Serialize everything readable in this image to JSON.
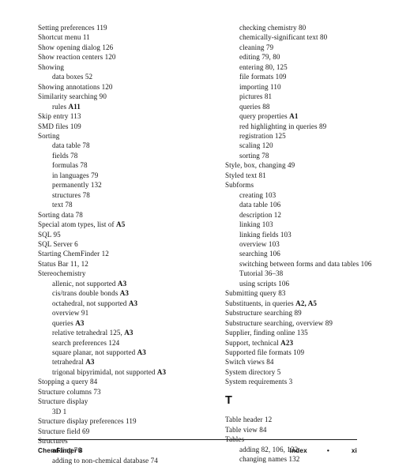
{
  "page": {
    "kind": "book-index-page",
    "background_color": "#ffffff",
    "text_color": "#161616"
  },
  "left_column": {
    "entries": [
      {
        "level": 0,
        "text": "Setting preferences 119"
      },
      {
        "level": 0,
        "text": "Shortcut menu 11"
      },
      {
        "level": 0,
        "text": "Show opening dialog 126"
      },
      {
        "level": 0,
        "text": "Show reaction centers 120"
      },
      {
        "level": 0,
        "text": "Showing"
      },
      {
        "level": 1,
        "text": "data boxes 52"
      },
      {
        "level": 0,
        "text": "Showing annotations 120"
      },
      {
        "level": 0,
        "text": "Similarity searching 90"
      },
      {
        "level": 1,
        "text": "rules ",
        "bold_suffix": "A11"
      },
      {
        "level": 0,
        "text": "Skip entry 113"
      },
      {
        "level": 0,
        "text": "SMD files 109"
      },
      {
        "level": 0,
        "text": "Sorting"
      },
      {
        "level": 1,
        "text": "data table 78"
      },
      {
        "level": 1,
        "text": "fields 78"
      },
      {
        "level": 1,
        "text": "formulas 78"
      },
      {
        "level": 1,
        "text": "in languages 79"
      },
      {
        "level": 1,
        "text": "permanently 132"
      },
      {
        "level": 1,
        "text": "structures 78"
      },
      {
        "level": 1,
        "text": "text 78"
      },
      {
        "level": 0,
        "text": "Sorting data 78"
      },
      {
        "level": 0,
        "text": "Special atom types, list of ",
        "bold_suffix": "A5"
      },
      {
        "level": 0,
        "text": "SQL 95"
      },
      {
        "level": 0,
        "text": "SQL Server 6"
      },
      {
        "level": 0,
        "text": "Starting ChemFinder 12"
      },
      {
        "level": 0,
        "text": "Status Bar 11, 12"
      },
      {
        "level": 0,
        "text": "Stereochemistry"
      },
      {
        "level": 1,
        "text": "allenic, not supported ",
        "bold_suffix": "A3"
      },
      {
        "level": 1,
        "text": "cis/trans double bonds ",
        "bold_suffix": "A3"
      },
      {
        "level": 1,
        "text": "octahedral, not supported ",
        "bold_suffix": "A3"
      },
      {
        "level": 1,
        "text": "overview 91"
      },
      {
        "level": 1,
        "text": "queries ",
        "bold_suffix": "A3"
      },
      {
        "level": 1,
        "text": "relative tetrahedral 125, ",
        "bold_suffix": "A3"
      },
      {
        "level": 1,
        "text": "search preferences 124"
      },
      {
        "level": 1,
        "text": "square planar, not supported ",
        "bold_suffix": "A3"
      },
      {
        "level": 1,
        "text": "tetrahedral ",
        "bold_suffix": "A3"
      },
      {
        "level": 1,
        "text": "trigonal bipyrimidal, not supported ",
        "bold_suffix": "A3"
      },
      {
        "level": 0,
        "text": "Stopping a query 84"
      },
      {
        "level": 0,
        "text": "Structure columns 73"
      },
      {
        "level": 0,
        "text": "Structure display"
      },
      {
        "level": 1,
        "text": "3D 1"
      },
      {
        "level": 0,
        "text": "Structure display preferences 119"
      },
      {
        "level": 0,
        "text": "Structure field 69"
      },
      {
        "level": 0,
        "text": "Structures"
      },
      {
        "level": 1,
        "text": "adding 76"
      },
      {
        "level": 1,
        "text": "adding to non-chemical database 74"
      }
    ]
  },
  "right_column": {
    "entries": [
      {
        "level": 1,
        "text": "checking chemistry 80"
      },
      {
        "level": 1,
        "text": "chemically-significant text 80"
      },
      {
        "level": 1,
        "text": "cleaning 79"
      },
      {
        "level": 1,
        "text": "editing 79, 80"
      },
      {
        "level": 1,
        "text": "entering 80, 125"
      },
      {
        "level": 1,
        "text": "file formats 109"
      },
      {
        "level": 1,
        "text": "importing 110"
      },
      {
        "level": 1,
        "text": "pictures 81"
      },
      {
        "level": 1,
        "text": "queries 88"
      },
      {
        "level": 1,
        "text": "query properties ",
        "bold_suffix": "A1"
      },
      {
        "level": 1,
        "text": "red highlighting in queries 89"
      },
      {
        "level": 1,
        "text": "registration 125"
      },
      {
        "level": 1,
        "text": "scaling 120"
      },
      {
        "level": 1,
        "text": "sorting 78"
      },
      {
        "level": 0,
        "text": "Style, box, changing 49"
      },
      {
        "level": 0,
        "text": "Styled text 81"
      },
      {
        "level": 0,
        "text": "Subforms"
      },
      {
        "level": 1,
        "text": "creating 103"
      },
      {
        "level": 1,
        "text": "data table 106"
      },
      {
        "level": 1,
        "text": "description 12"
      },
      {
        "level": 1,
        "text": "linking 103"
      },
      {
        "level": 1,
        "text": "linking fields 103"
      },
      {
        "level": 1,
        "text": "overview 103"
      },
      {
        "level": 1,
        "text": "searching 106"
      },
      {
        "level": 1,
        "text": "switching between forms and data tables 106"
      },
      {
        "level": 1,
        "text": "Tutorial 36–38"
      },
      {
        "level": 1,
        "text": "using scripts 106"
      },
      {
        "level": 0,
        "text": "Submitting query 83"
      },
      {
        "level": 0,
        "text": "Substituents, in queries ",
        "bold_suffix": "A2, A5"
      },
      {
        "level": 0,
        "text": "Substructure searching 89"
      },
      {
        "level": 0,
        "text": "Substructure searching, overview 89"
      },
      {
        "level": 0,
        "text": "Supplier, finding online 135"
      },
      {
        "level": 0,
        "text": "Support, technical ",
        "bold_suffix": "A23"
      },
      {
        "level": 0,
        "text": "Supported file formats 109"
      },
      {
        "level": 0,
        "text": "Switch views 84"
      },
      {
        "level": 0,
        "text": "System directory 5"
      },
      {
        "level": 0,
        "text": "System requirements 3"
      }
    ],
    "section_heading": "T",
    "entries_after_heading": [
      {
        "level": 0,
        "text": "Table header 12"
      },
      {
        "level": 0,
        "text": "Table view 84"
      },
      {
        "level": 0,
        "text": "Tables"
      },
      {
        "level": 1,
        "text": "adding 82, 106, 132"
      },
      {
        "level": 1,
        "text": "changing names 132"
      }
    ]
  },
  "footer": {
    "book_title": "ChemFinder 8",
    "section_label": "Index",
    "separator": "•",
    "page_number": "xi"
  }
}
